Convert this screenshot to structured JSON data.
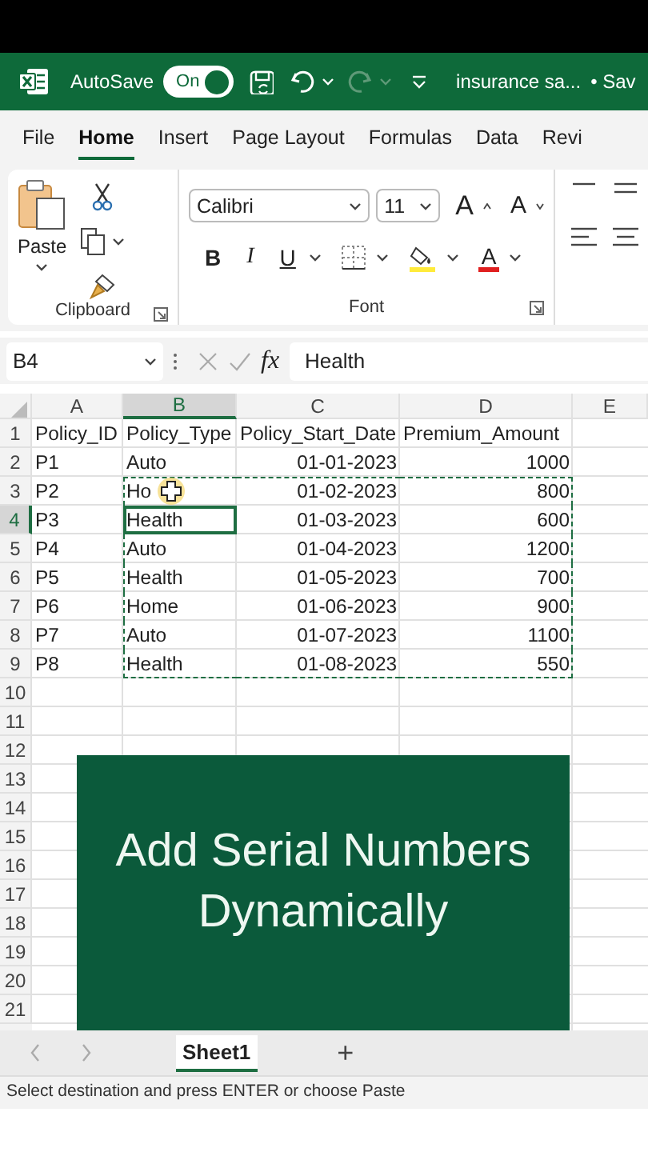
{
  "title_bar": {
    "autosave_label": "AutoSave",
    "autosave_toggle": {
      "label": "On",
      "on": true
    },
    "file_name": "insurance sa...",
    "save_status": "• Sav"
  },
  "ribbon_tabs": [
    {
      "label": "File",
      "selected": false
    },
    {
      "label": "Home",
      "selected": true
    },
    {
      "label": "Insert",
      "selected": false
    },
    {
      "label": "Page Layout",
      "selected": false
    },
    {
      "label": "Formulas",
      "selected": false
    },
    {
      "label": "Data",
      "selected": false
    },
    {
      "label": "Revi",
      "selected": false
    }
  ],
  "ribbon": {
    "paste_label": "Paste",
    "font_name": "Calibri",
    "font_size": "11",
    "grow_font": "A",
    "shrink_font": "A",
    "bold": "B",
    "italic": "I",
    "underline": "U",
    "font_color": "A",
    "groups": [
      "Clipboard",
      "Font"
    ]
  },
  "formula_bar": {
    "cell_ref": "B4",
    "fx": "fx",
    "value": "Health"
  },
  "sheet": {
    "columns": [
      {
        "label": "A",
        "selected": false,
        "copied": false
      },
      {
        "label": "B",
        "selected": true,
        "copied": true
      },
      {
        "label": "C",
        "selected": false,
        "copied": true
      },
      {
        "label": "D",
        "selected": false,
        "copied": true
      },
      {
        "label": "E",
        "selected": false,
        "copied": false
      }
    ],
    "rows": [
      {
        "number": "1",
        "kind": "header",
        "selected": false,
        "copied": false,
        "cells": [
          "Policy_ID",
          "Policy_Type",
          "Policy_Start_Date",
          "Premium_Amount"
        ]
      },
      {
        "number": "2",
        "kind": "data",
        "selected": false,
        "copied": false,
        "cells": [
          "P1",
          "Auto",
          "01-01-2023",
          "1000"
        ]
      },
      {
        "number": "3",
        "kind": "data",
        "selected": false,
        "copied": true,
        "cells": [
          "P2",
          "Ho",
          "01-02-2023",
          "800"
        ]
      },
      {
        "number": "4",
        "kind": "data",
        "selected": true,
        "copied": true,
        "cells": [
          "P3",
          "Health",
          "01-03-2023",
          "600"
        ]
      },
      {
        "number": "5",
        "kind": "data",
        "selected": false,
        "copied": true,
        "cells": [
          "P4",
          "Auto",
          "01-04-2023",
          "1200"
        ]
      },
      {
        "number": "6",
        "kind": "data",
        "selected": false,
        "copied": true,
        "cells": [
          "P5",
          "Health",
          "01-05-2023",
          "700"
        ]
      },
      {
        "number": "7",
        "kind": "data",
        "selected": false,
        "copied": true,
        "cells": [
          "P6",
          "Home",
          "01-06-2023",
          "900"
        ]
      },
      {
        "number": "8",
        "kind": "data",
        "selected": false,
        "copied": true,
        "cells": [
          "P7",
          "Auto",
          "01-07-2023",
          "1100"
        ]
      },
      {
        "number": "9",
        "kind": "data",
        "selected": false,
        "copied": true,
        "cells": [
          "P8",
          "Health",
          "01-08-2023",
          "550"
        ]
      }
    ],
    "empty_rows": [
      "10",
      "11",
      "12",
      "13",
      "14",
      "15",
      "16",
      "17",
      "18",
      "19",
      "20",
      "21"
    ]
  },
  "overlay": {
    "lines": [
      "Add Serial Numbers",
      "Dynamically"
    ]
  },
  "sheet_tabs": [
    {
      "label": "Sheet1",
      "selected": true
    }
  ],
  "add_sheet": "+",
  "status_bar": "Select destination and press ENTER or choose Paste"
}
